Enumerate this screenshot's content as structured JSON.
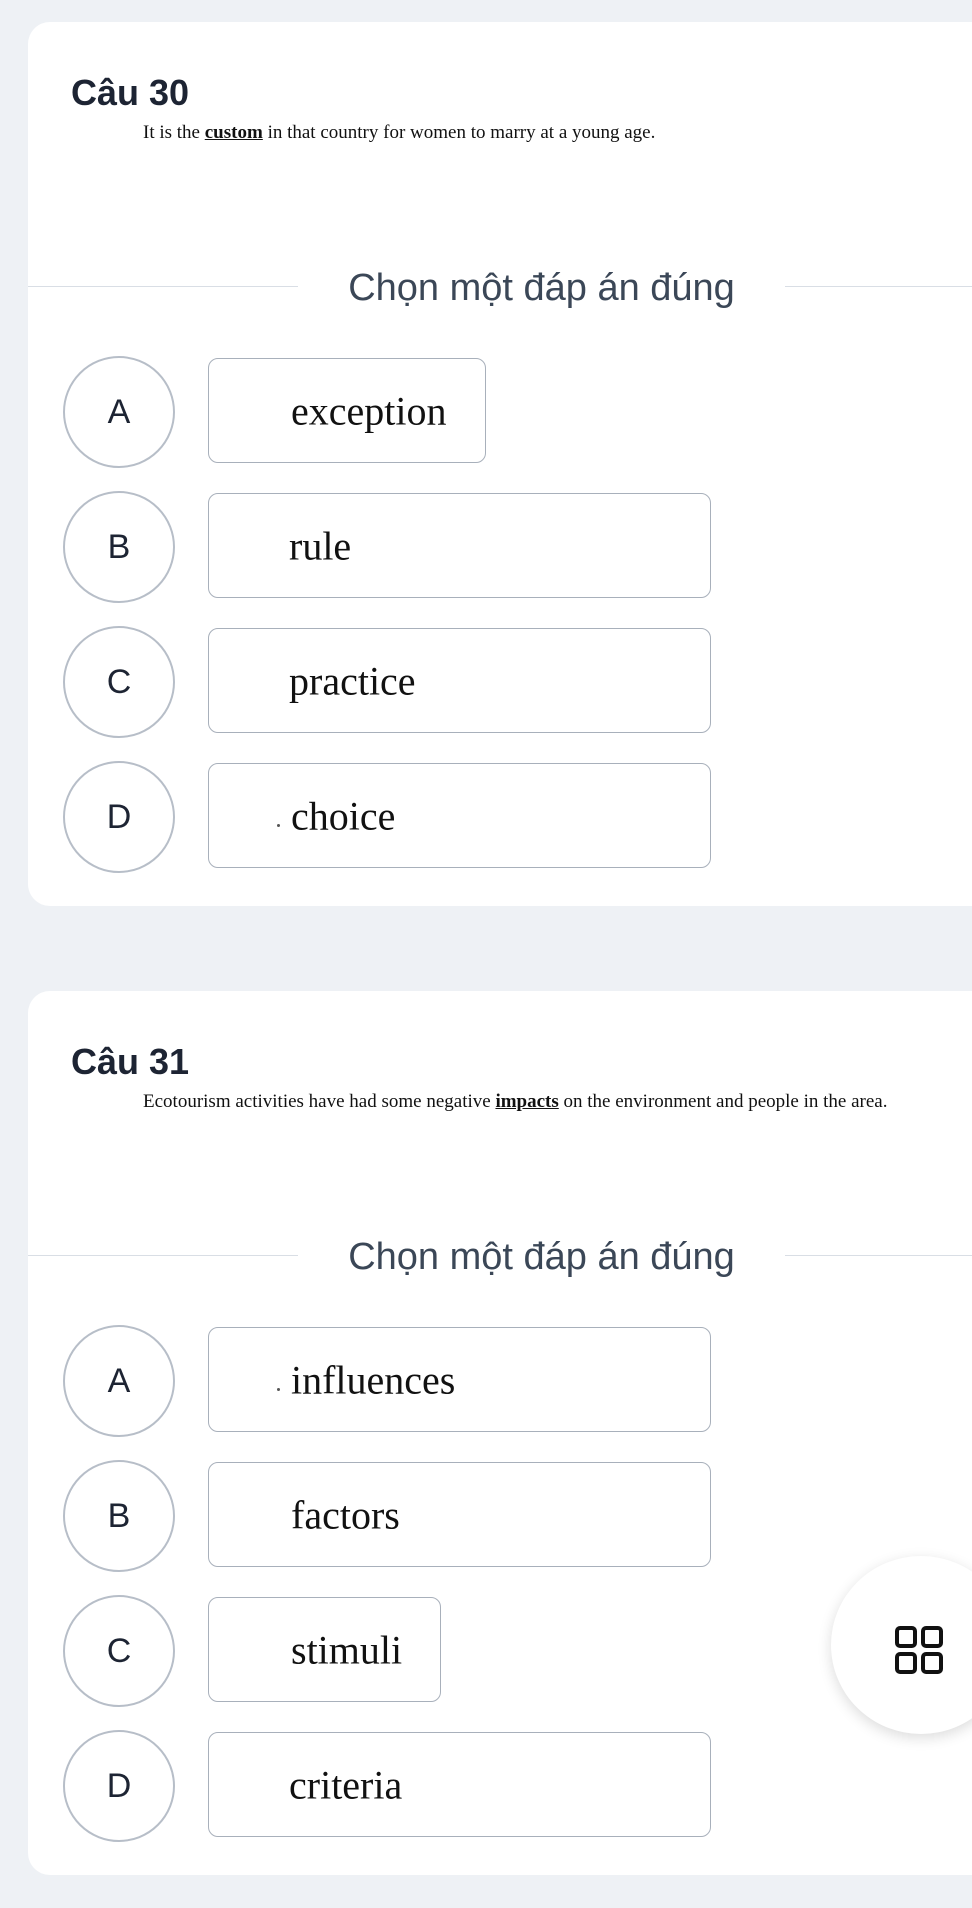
{
  "instruction_label": "Chọn một đáp án đúng",
  "questions": [
    {
      "title": "Câu 30",
      "stem_before": "It is the ",
      "stem_keyword": "custom",
      "stem_after": " in that country for women to marry at a young age.",
      "options": [
        {
          "letter": "A",
          "text": "exception"
        },
        {
          "letter": "B",
          "text": "rule"
        },
        {
          "letter": "C",
          "text": "practice"
        },
        {
          "letter": "D",
          "text": "choice"
        }
      ]
    },
    {
      "title": "Câu 31",
      "stem_before": "Ecotourism activities have had some negative ",
      "stem_keyword": "impacts",
      "stem_after": " on the environment and people in the area.",
      "options": [
        {
          "letter": "A",
          "text": "influences"
        },
        {
          "letter": "B",
          "text": "factors"
        },
        {
          "letter": "C",
          "text": "stimuli"
        },
        {
          "letter": "D",
          "text": "criteria"
        }
      ]
    }
  ],
  "fab": {
    "icon": "grid-menu-icon"
  }
}
